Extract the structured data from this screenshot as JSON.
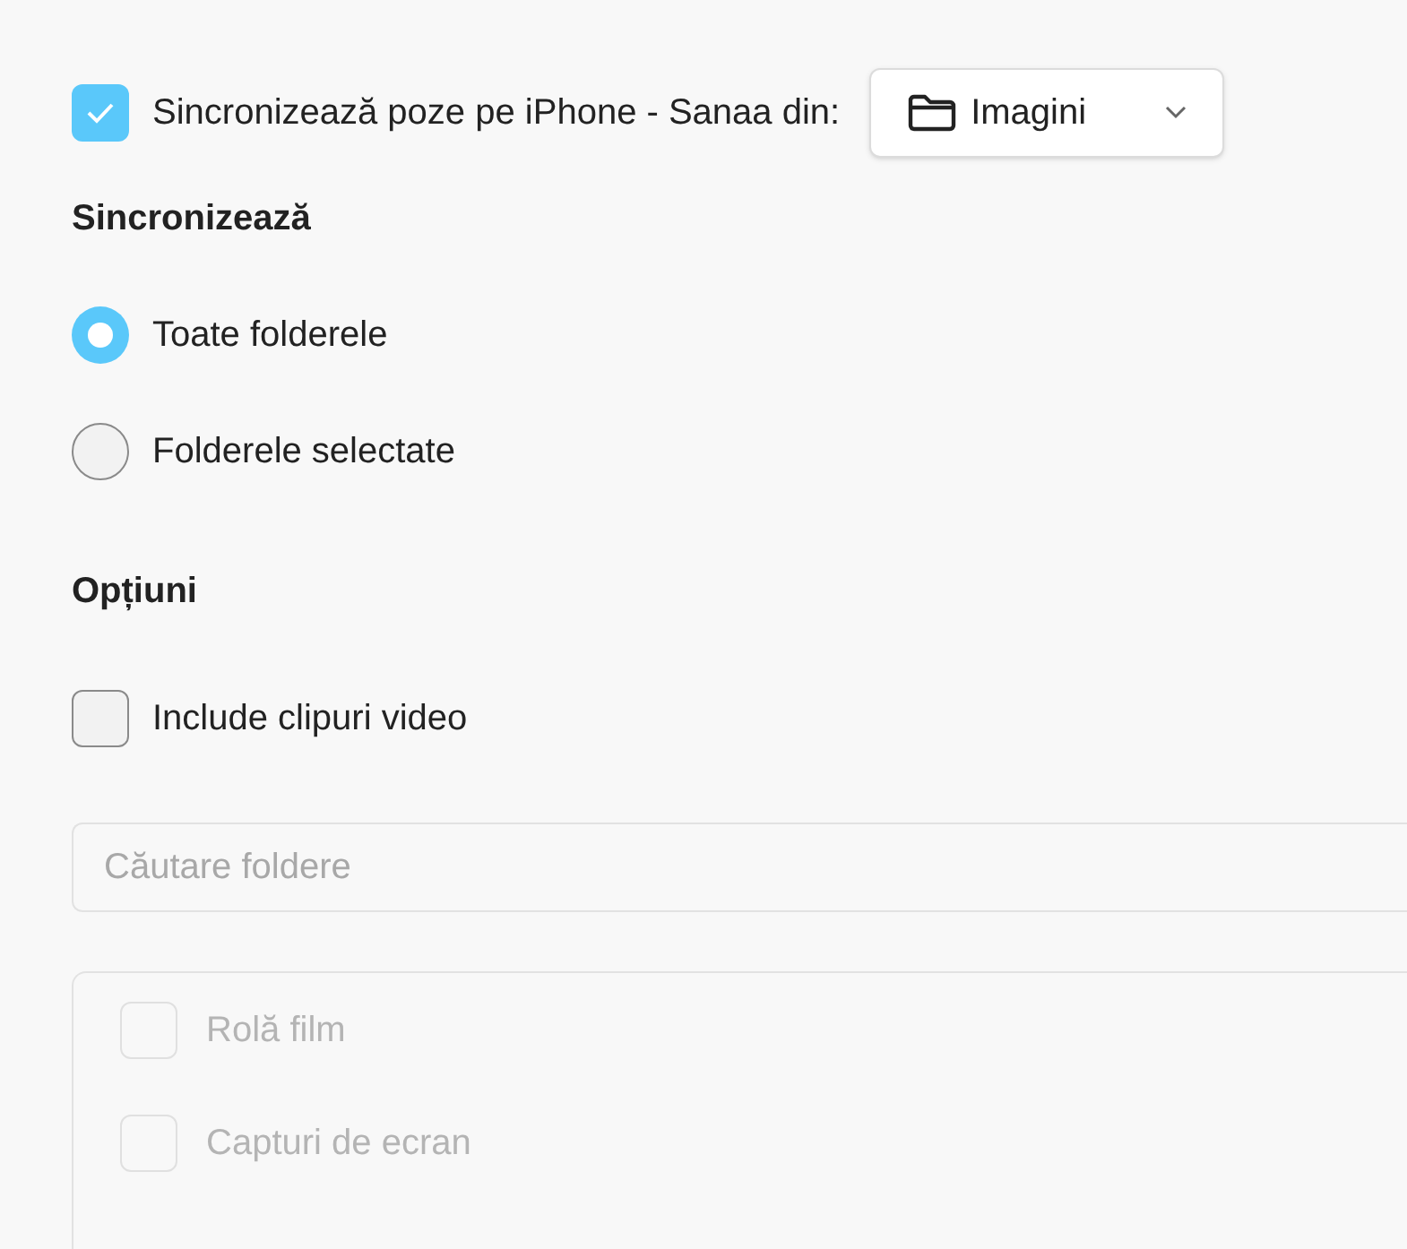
{
  "sync_checkbox": {
    "label": "Sincronizează poze pe iPhone - Sanaa din:",
    "checked": true
  },
  "source_dropdown": {
    "value": "Imagini"
  },
  "sync_section": {
    "title": "Sincronizează",
    "options": [
      {
        "label": "Toate folderele",
        "selected": true
      },
      {
        "label": "Folderele selectate",
        "selected": false
      }
    ]
  },
  "options_section": {
    "title": "Opțiuni",
    "items": [
      {
        "label": "Include clipuri video",
        "checked": false
      }
    ]
  },
  "search": {
    "placeholder": "Căutare foldere"
  },
  "folders": [
    {
      "label": "Rolă film",
      "checked": false,
      "disabled": true
    },
    {
      "label": "Capturi de ecran",
      "checked": false,
      "disabled": true
    }
  ]
}
